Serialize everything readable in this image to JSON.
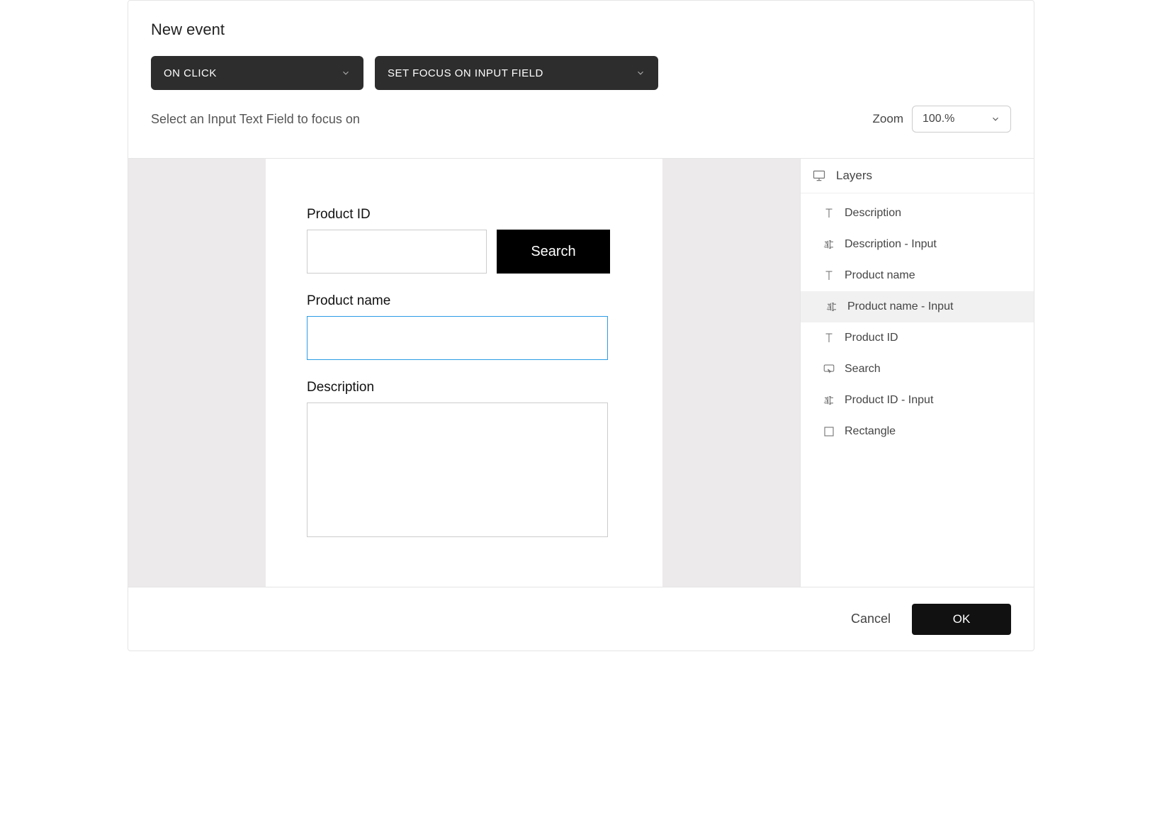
{
  "header": {
    "title": "New event",
    "trigger": "ON CLICK",
    "action": "SET FOCUS ON INPUT FIELD",
    "instruction": "Select an Input Text Field to focus on",
    "zoom_label": "Zoom",
    "zoom_value": "100.%"
  },
  "canvas": {
    "product_id_label": "Product ID",
    "product_name_label": "Product name",
    "description_label": "Description",
    "search_button": "Search"
  },
  "layers": {
    "title": "Layers",
    "items": [
      {
        "label": "Description",
        "type": "text",
        "selected": false
      },
      {
        "label": "Description - Input",
        "type": "input",
        "selected": false
      },
      {
        "label": "Product name",
        "type": "text",
        "selected": false
      },
      {
        "label": "Product name - Input",
        "type": "input",
        "selected": true
      },
      {
        "label": "Product ID",
        "type": "text",
        "selected": false
      },
      {
        "label": "Search",
        "type": "button",
        "selected": false
      },
      {
        "label": "Product ID - Input",
        "type": "input",
        "selected": false
      },
      {
        "label": "Rectangle",
        "type": "rect",
        "selected": false
      }
    ]
  },
  "footer": {
    "cancel": "Cancel",
    "ok": "OK"
  }
}
